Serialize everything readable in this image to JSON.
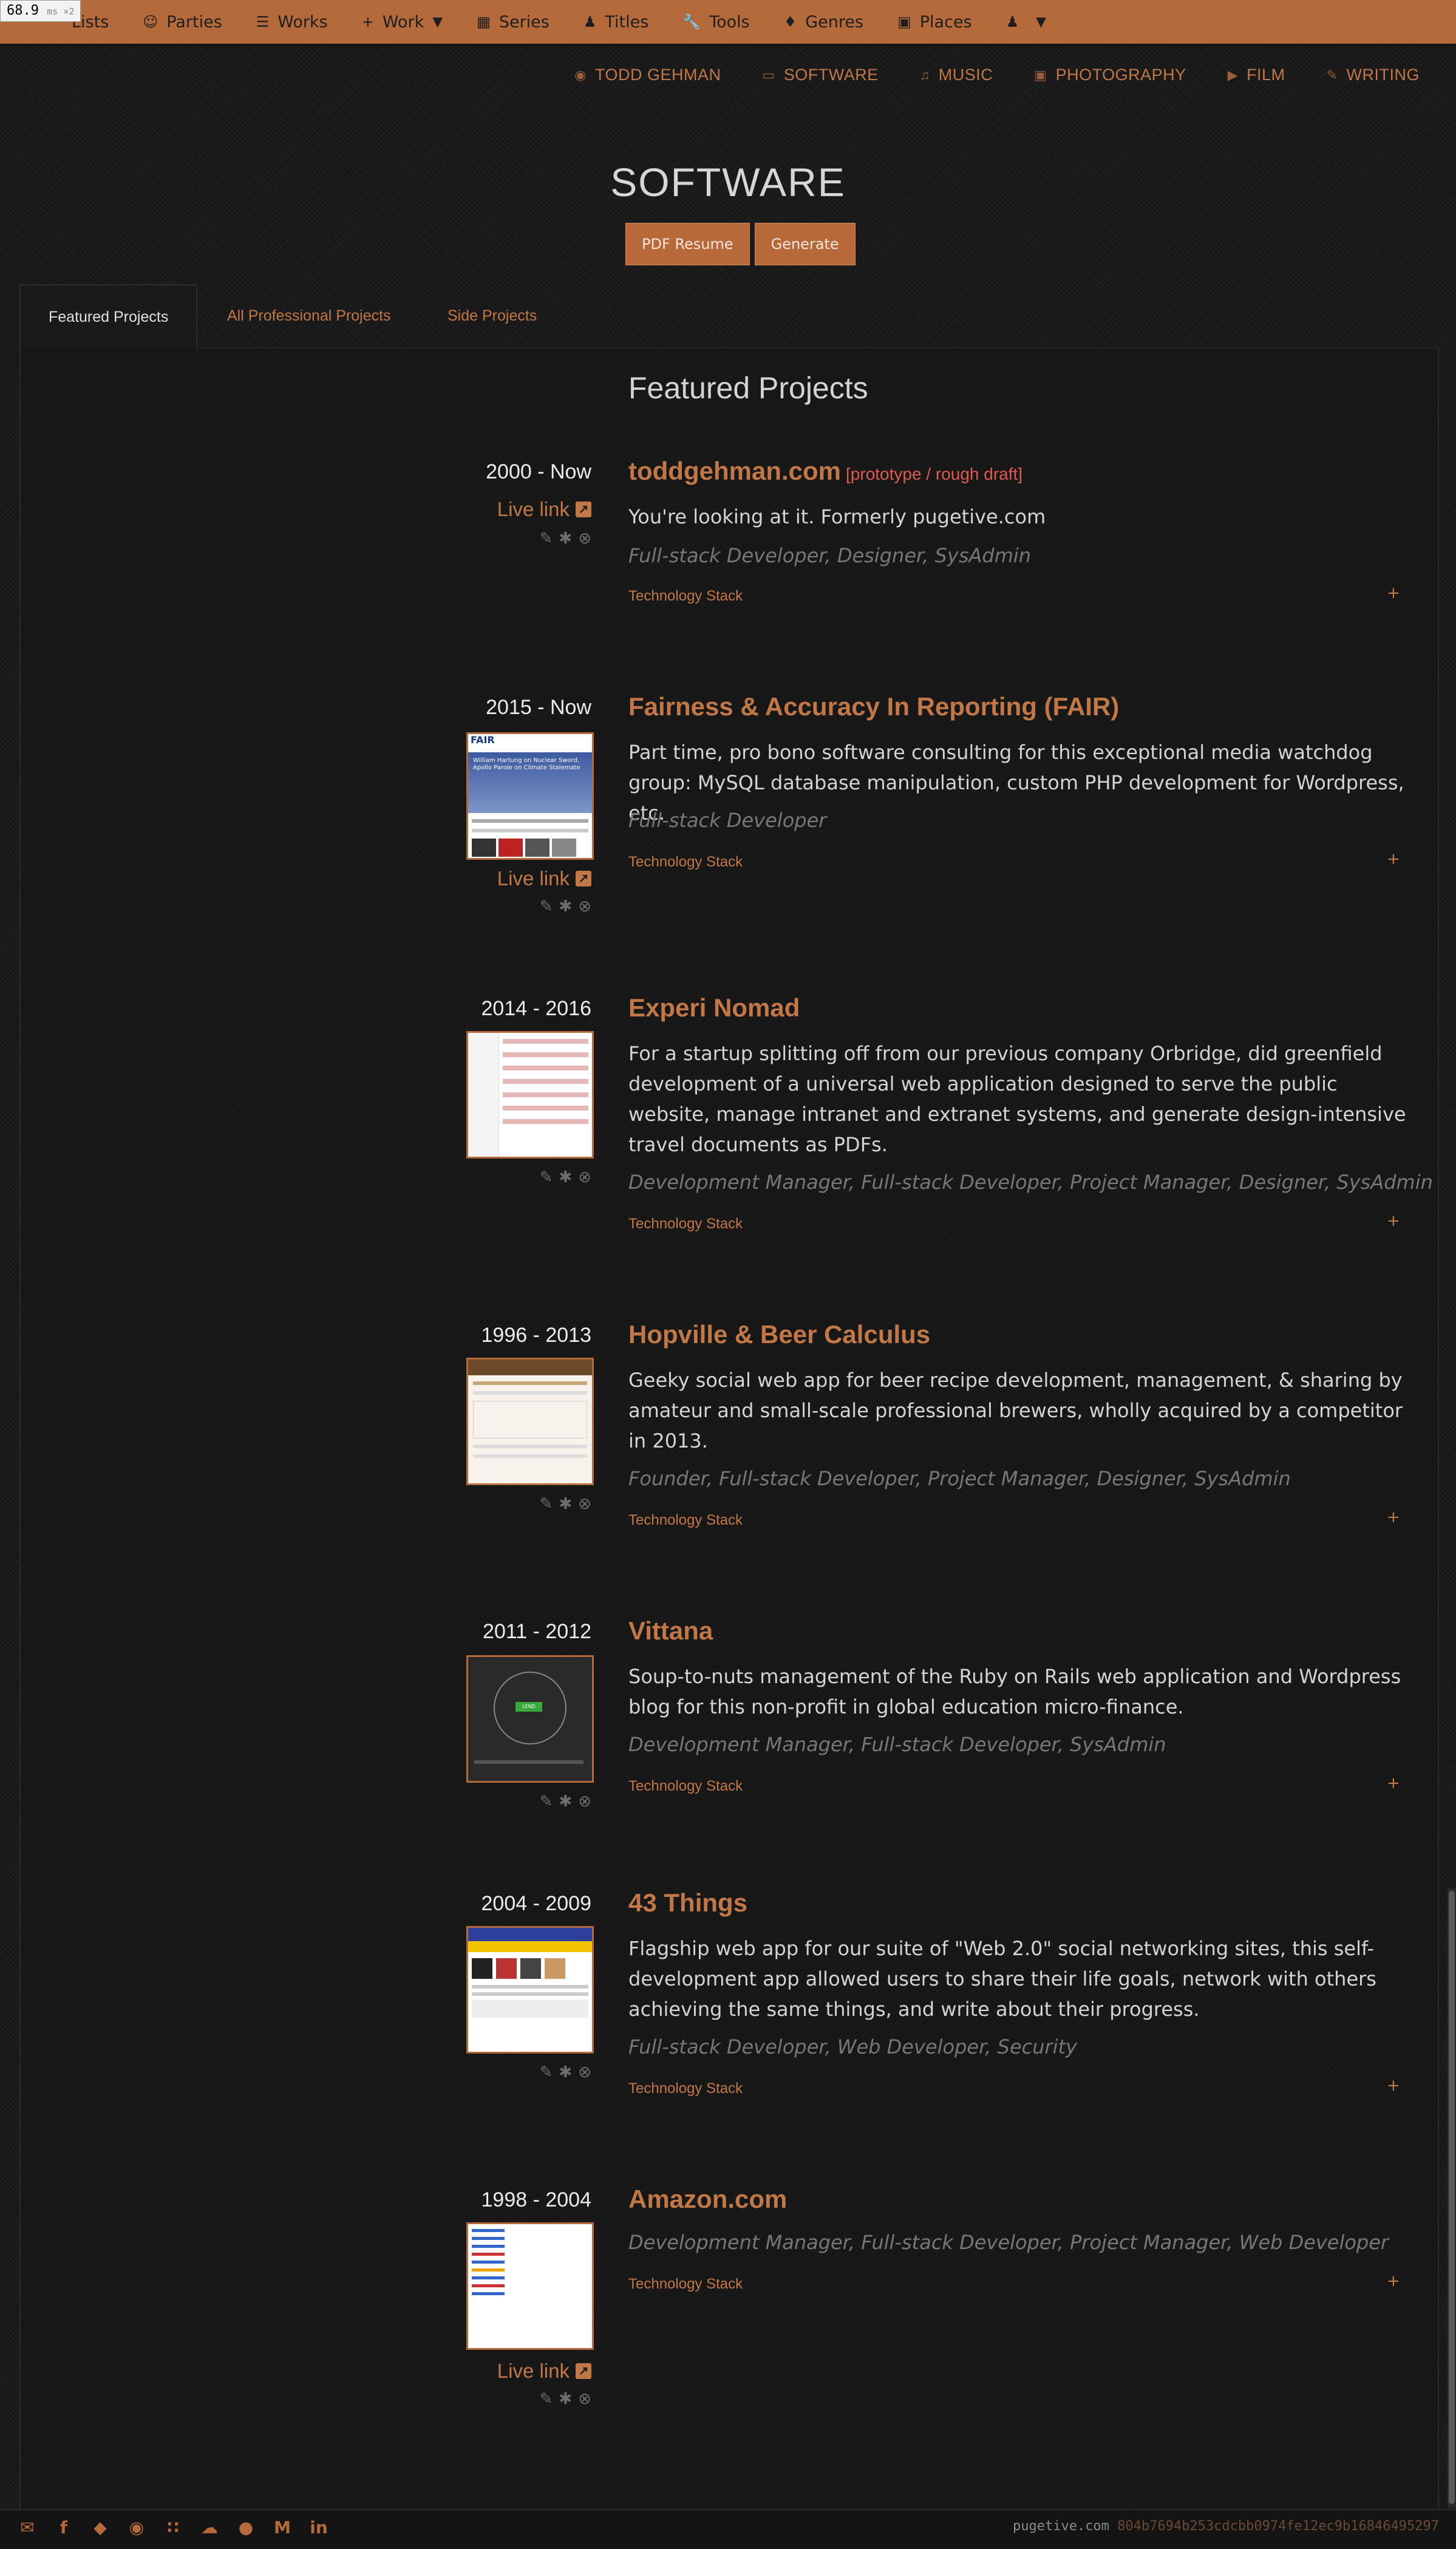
{
  "perf": {
    "value": "68.9",
    "unit": "ms ×2"
  },
  "adminbar": {
    "items": [
      {
        "icon": "list-icon",
        "label": "Lists"
      },
      {
        "icon": "users-icon",
        "label": "Parties"
      },
      {
        "icon": "list-icon",
        "label": "Works"
      },
      {
        "icon": "plus-icon",
        "label": "Work"
      },
      {
        "icon": "series-icon",
        "label": "Series"
      },
      {
        "icon": "user-icon",
        "label": "Titles"
      },
      {
        "icon": "wrench-icon",
        "label": "Tools"
      },
      {
        "icon": "tag-icon",
        "label": "Genres"
      },
      {
        "icon": "places-icon",
        "label": "Places"
      }
    ]
  },
  "sitenav": [
    {
      "icon": "target-icon",
      "label": "TODD GEHMAN"
    },
    {
      "icon": "laptop-icon",
      "label": "SOFTWARE"
    },
    {
      "icon": "music-icon",
      "label": "MUSIC"
    },
    {
      "icon": "camera-icon",
      "label": "PHOTOGRAPHY"
    },
    {
      "icon": "video-icon",
      "label": "FILM"
    },
    {
      "icon": "pencil-icon",
      "label": "WRITING"
    }
  ],
  "page": {
    "title": "SOFTWARE",
    "buttons": [
      "PDF Resume",
      "Generate"
    ],
    "tabs": [
      "Featured Projects",
      "All Professional Projects",
      "Side Projects"
    ],
    "section_title": "Featured Projects"
  },
  "projects": [
    {
      "dates": "2000 - Now",
      "title": "toddgehman.com",
      "note": "[prototype / rough draft]",
      "description": "You're looking at it. Formerly pugetive.com",
      "roles": "Full-stack Developer, Designer, SysAdmin",
      "tech": "Technology Stack",
      "live_link": "Live link"
    },
    {
      "dates": "2015 - Now",
      "title": "Fairness & Accuracy In Reporting (FAIR)",
      "description": "Part time, pro bono software consulting for this exceptional media watchdog group: MySQL database manipulation, custom PHP development for Wordpress, etc.",
      "roles": "Full-stack Developer",
      "tech": "Technology Stack",
      "live_link": "Live link"
    },
    {
      "dates": "2014 - 2016",
      "title": "Experi Nomad",
      "description": "For a startup splitting off from our previous company Orbridge, did greenfield development of a universal web application designed to serve the public website, manage intranet and extranet systems, and generate design-intensive travel documents as PDFs.",
      "roles": "Development Manager, Full-stack Developer, Project Manager, Designer, SysAdmin",
      "tech": "Technology Stack"
    },
    {
      "dates": "1996 - 2013",
      "title": "Hopville & Beer Calculus",
      "description": "Geeky social web app for beer recipe development, management, & sharing by amateur and small-scale professional brewers, wholly acquired by a competitor in 2013.",
      "roles": "Founder, Full-stack Developer, Project Manager, Designer, SysAdmin",
      "tech": "Technology Stack"
    },
    {
      "dates": "2011 - 2012",
      "title": "Vittana",
      "description": "Soup-to-nuts management of the Ruby on Rails web application and Wordpress blog for this non-profit in global education micro-finance.",
      "roles": "Development Manager, Full-stack Developer, SysAdmin",
      "tech": "Technology Stack"
    },
    {
      "dates": "2004 - 2009",
      "title": "43 Things",
      "description": "Flagship web app for our suite of \"Web 2.0\" social networking sites, this self-development app allowed users to share their life goals, network with others achieving the same things, and write about their progress.",
      "roles": "Full-stack Developer, Web Developer, Security",
      "tech": "Technology Stack"
    },
    {
      "dates": "1998 - 2004",
      "title": "Amazon.com",
      "roles": "Development Manager, Full-stack Developer, Project Manager, Web Developer",
      "tech": "Technology Stack",
      "live_link": "Live link"
    }
  ],
  "thumb_text": {
    "fair_logo": "FAIR",
    "fair_headline": "William Hartung on Nuclear Sword, Apollo Parole on Climate Stalemate",
    "vittana_button": "LEND"
  },
  "footer": {
    "socials": [
      "mail-icon",
      "facebook-icon",
      "twitter-icon",
      "instagram-icon",
      "flickr-icon",
      "soundcloud-icon",
      "github-icon",
      "medium-icon",
      "linkedin-icon"
    ],
    "site": "pugetive.com",
    "hash": "804b7694b253cdcbb0974fe12ec9b16846495297"
  },
  "colors": {
    "accent": "#b56a3c",
    "link": "#c27846",
    "note": "#e05a4f",
    "background": "#1b1b1b"
  }
}
